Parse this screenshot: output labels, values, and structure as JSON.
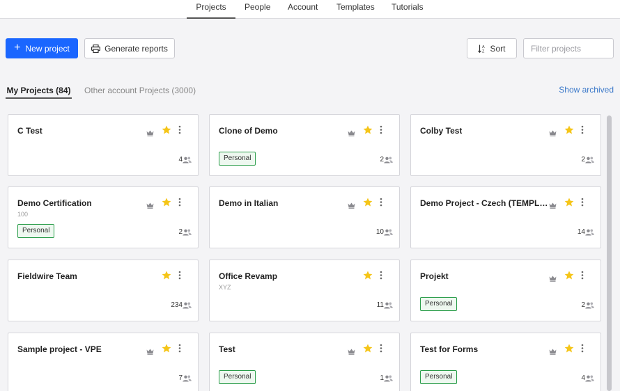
{
  "nav": {
    "tabs": [
      "Projects",
      "People",
      "Account",
      "Templates",
      "Tutorials"
    ],
    "active": "Projects"
  },
  "toolbar": {
    "new_project": "New project",
    "generate_reports": "Generate reports",
    "sort": "Sort",
    "filter_placeholder": "Filter projects"
  },
  "subtabs": {
    "mine": "My Projects (84)",
    "other": "Other account Projects (3000)",
    "show_archived": "Show archived"
  },
  "icons": {
    "plus": "plus-icon",
    "printer": "printer-icon",
    "sort": "sort-icon",
    "crown": "crown-icon",
    "star": "star-icon",
    "kebab": "more-vertical-icon",
    "people": "people-icon"
  },
  "colors": {
    "primary": "#1a66ff",
    "star": "#f5c518",
    "badge_border": "#2a9d4a",
    "link": "#3a78c9"
  },
  "projects": [
    {
      "title": "C Test",
      "sub": "",
      "badge": "",
      "members": "4",
      "crown": true
    },
    {
      "title": "Clone of Demo",
      "sub": "",
      "badge": "Personal",
      "members": "2",
      "crown": true
    },
    {
      "title": "Colby Test",
      "sub": "",
      "badge": "",
      "members": "2",
      "crown": true
    },
    {
      "title": "Demo Certification",
      "sub": "100",
      "badge": "Personal",
      "members": "2",
      "crown": true
    },
    {
      "title": "Demo in Italian",
      "sub": "",
      "badge": "",
      "members": "10",
      "crown": true
    },
    {
      "title": "Demo Project - Czech (TEMPLATE)",
      "sub": "",
      "badge": "",
      "members": "14",
      "crown": true
    },
    {
      "title": "Fieldwire Team",
      "sub": "",
      "badge": "",
      "members": "234",
      "crown": false
    },
    {
      "title": "Office Revamp",
      "sub": "XYZ",
      "badge": "",
      "members": "11",
      "crown": false
    },
    {
      "title": "Projekt",
      "sub": "",
      "badge": "Personal",
      "members": "2",
      "crown": true
    },
    {
      "title": "Sample project - VPE",
      "sub": "",
      "badge": "",
      "members": "7",
      "crown": true
    },
    {
      "title": "Test",
      "sub": "",
      "badge": "Personal",
      "members": "1",
      "crown": true
    },
    {
      "title": "Test for Forms",
      "sub": "",
      "badge": "Personal",
      "members": "4",
      "crown": true
    }
  ]
}
